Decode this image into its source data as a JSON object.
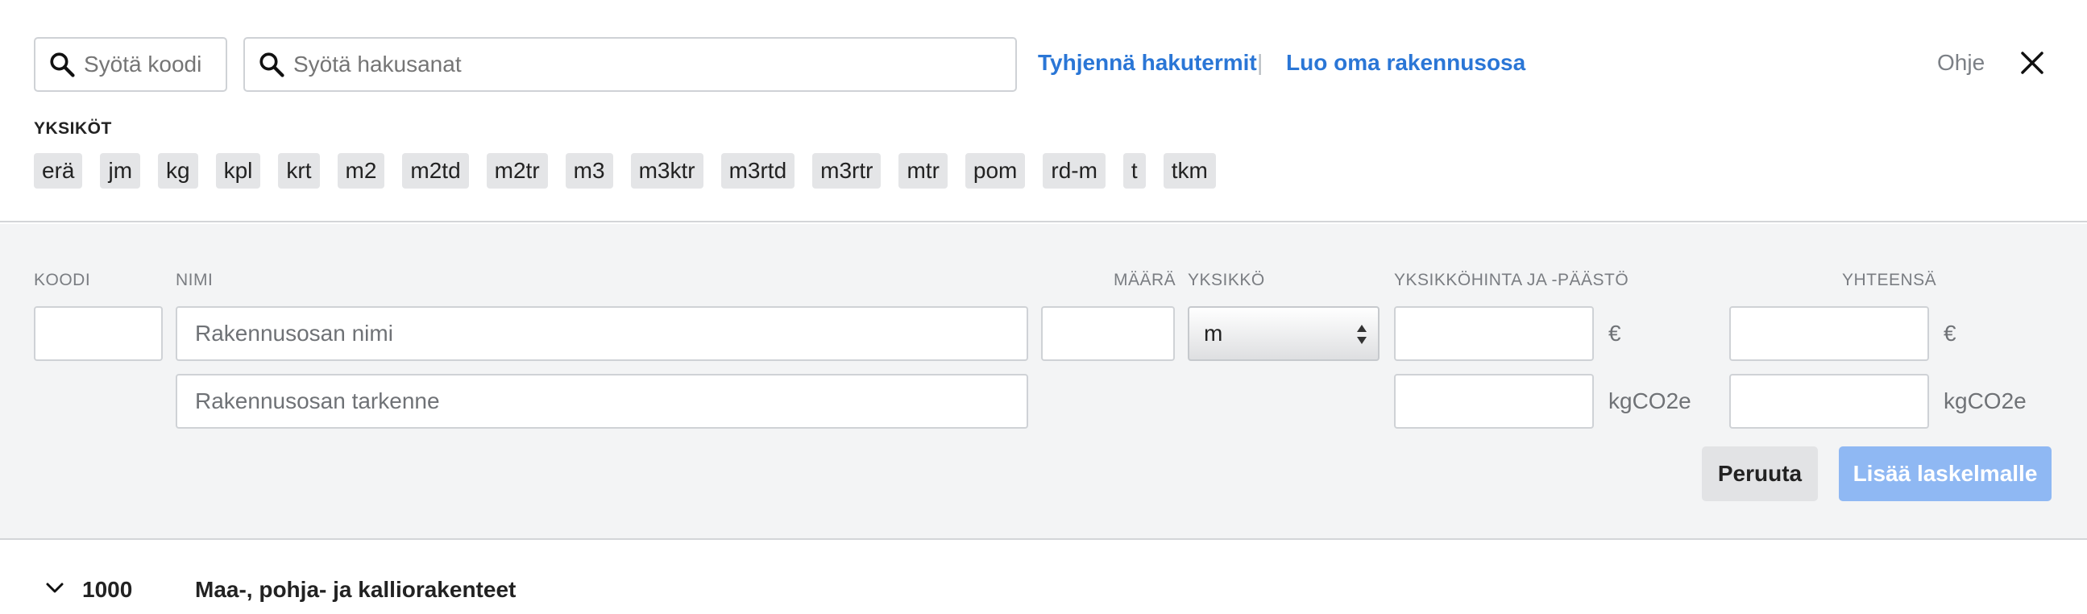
{
  "search": {
    "code_placeholder": "Syötä koodi",
    "terms_placeholder": "Syötä hakusanat"
  },
  "links": {
    "clear_terms": "Tyhjennä hakutermit",
    "separator": "|",
    "create_own": "Luo oma rakennusosa",
    "help": "Ohje"
  },
  "units": {
    "label": "YKSIKÖT",
    "items": [
      "erä",
      "jm",
      "kg",
      "kpl",
      "krt",
      "m2",
      "m2td",
      "m2tr",
      "m3",
      "m3ktr",
      "m3rtd",
      "m3rtr",
      "mtr",
      "pom",
      "rd-m",
      "t",
      "tkm"
    ]
  },
  "form": {
    "columns": {
      "code": "KOODI",
      "name": "NIMI",
      "amount": "MÄÄRÄ",
      "unit": "YKSIKKÖ",
      "unit_price": "YKSIKKÖHINTA JA -PÄÄSTÖ",
      "total": "YHTEENSÄ"
    },
    "name_placeholder": "Rakennusosan nimi",
    "detail_placeholder": "Rakennusosan tarkenne",
    "unit_value": "m",
    "currency_suffix": "€",
    "emission_suffix": "kgCO2e",
    "cancel_label": "Peruuta",
    "add_label": "Lisää laskelmalle",
    "add_button_color": "#8fb8f3"
  },
  "groups": [
    {
      "code": "1000",
      "name": "Maa-, pohja- ja kalliorakenteet"
    }
  ],
  "colors": {
    "link": "#2a76d6",
    "form_background": "#f3f4f5"
  }
}
